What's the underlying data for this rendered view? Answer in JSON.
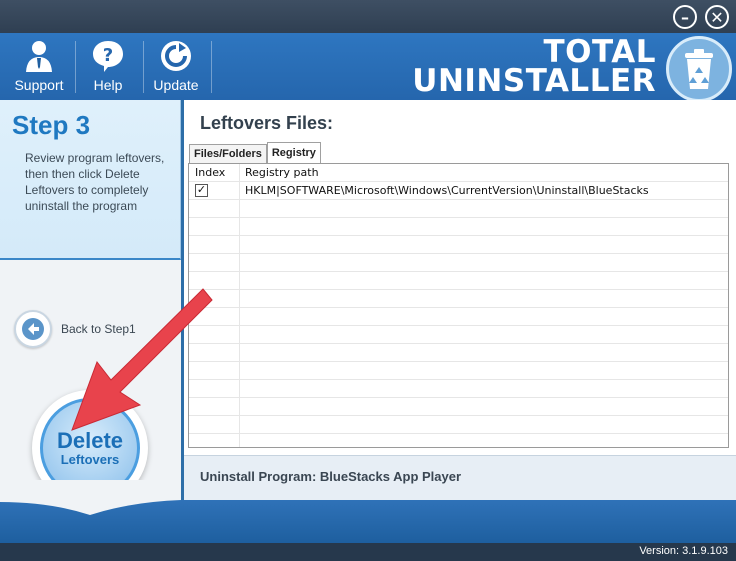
{
  "window": {
    "minimize_icon": "minimize-icon",
    "close_icon": "close-icon"
  },
  "toolbar": {
    "items": [
      {
        "label": "Support",
        "icon": "support-person-icon"
      },
      {
        "label": "Help",
        "icon": "help-question-icon"
      },
      {
        "label": "Update",
        "icon": "update-refresh-icon"
      }
    ]
  },
  "brand": {
    "line1": "TOTAL",
    "line2": "UNINSTALLER",
    "logo_icon": "recycle-bin-icon"
  },
  "step": {
    "title": "Step 3",
    "description": "Review program leftovers, then then click Delete Leftovers to completely uninstall the program"
  },
  "back": {
    "label": "Back to Step1",
    "icon": "back-arrow-icon"
  },
  "delete_button": {
    "line1": "Delete",
    "line2": "Leftovers"
  },
  "leftovers": {
    "title": "Leftovers Files:",
    "tabs": [
      {
        "label": "Files/Folders",
        "active": false
      },
      {
        "label": "Registry",
        "active": true
      }
    ],
    "columns": [
      "Index",
      "Registry path"
    ],
    "rows": [
      {
        "checked": true,
        "path": "HKLM|SOFTWARE\\Microsoft\\Windows\\CurrentVersion\\Uninstall\\BlueStacks"
      }
    ]
  },
  "program_info": "Uninstall Program: BlueStacks App Player",
  "version": "Version: 3.1.9.103",
  "colors": {
    "header_blue": "#2a6fb8",
    "accent_arrow": "#e8434c",
    "step_title": "#1f79c1"
  }
}
